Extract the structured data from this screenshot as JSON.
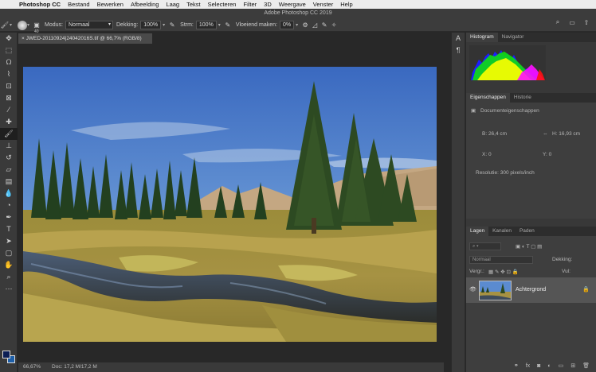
{
  "menubar": {
    "app": "Photoshop CC",
    "items": [
      "Bestand",
      "Bewerken",
      "Afbeelding",
      "Laag",
      "Tekst",
      "Selecteren",
      "Filter",
      "3D",
      "Weergave",
      "Venster",
      "Help"
    ]
  },
  "window_title": "Adobe Photoshop CC 2019",
  "options": {
    "brush_size": "40",
    "mode_label": "Modus:",
    "mode_value": "Normaal",
    "opacity_label": "Dekking:",
    "opacity_value": "100%",
    "flow_label": "Strm:",
    "flow_value": "100%",
    "smoothing_label": "Vloeiend maken:",
    "smoothing_value": "0%"
  },
  "document": {
    "tab_title": "JWED-20110924|24042016S.tif @ 66,7% (RGB/8)",
    "status_zoom": "66,67%",
    "status_doc": "Doc: 17,2 M/17,2 M"
  },
  "colors": {
    "foreground": "#0c1f55",
    "background": "#1e5fa8"
  },
  "toolbar_icons": [
    "move-icon",
    "marquee-icon",
    "lasso-icon",
    "quick-select-icon",
    "crop-icon",
    "frame-icon",
    "eyedropper-icon",
    "healing-icon",
    "brush-icon",
    "stamp-icon",
    "history-brush-icon",
    "eraser-icon",
    "gradient-icon",
    "blur-icon",
    "dodge-icon",
    "pen-icon",
    "type-icon",
    "path-select-icon",
    "rectangle-icon",
    "hand-icon",
    "zoom-icon",
    "more-icon"
  ],
  "panels": {
    "top_tabs": [
      "Histogram",
      "Navigator"
    ],
    "mid_tabs": [
      "Eigenschappen",
      "Historie"
    ],
    "properties": {
      "title": "Documenteigenschappen",
      "width": "B: 26,4 cm",
      "height": "H: 16,93 cm",
      "x": "X: 0",
      "y": "Y: 0",
      "resolution": "Resolutie: 300 pixels/inch"
    },
    "layer_tabs": [
      "Lagen",
      "Kanalen",
      "Paden"
    ],
    "layers": {
      "blend_mode": "Normaal",
      "opacity_label": "Dekking:",
      "lock_label": "Vergr.:",
      "fill_label": "Vul:",
      "items": [
        {
          "name": "Achtergrond"
        }
      ]
    }
  }
}
